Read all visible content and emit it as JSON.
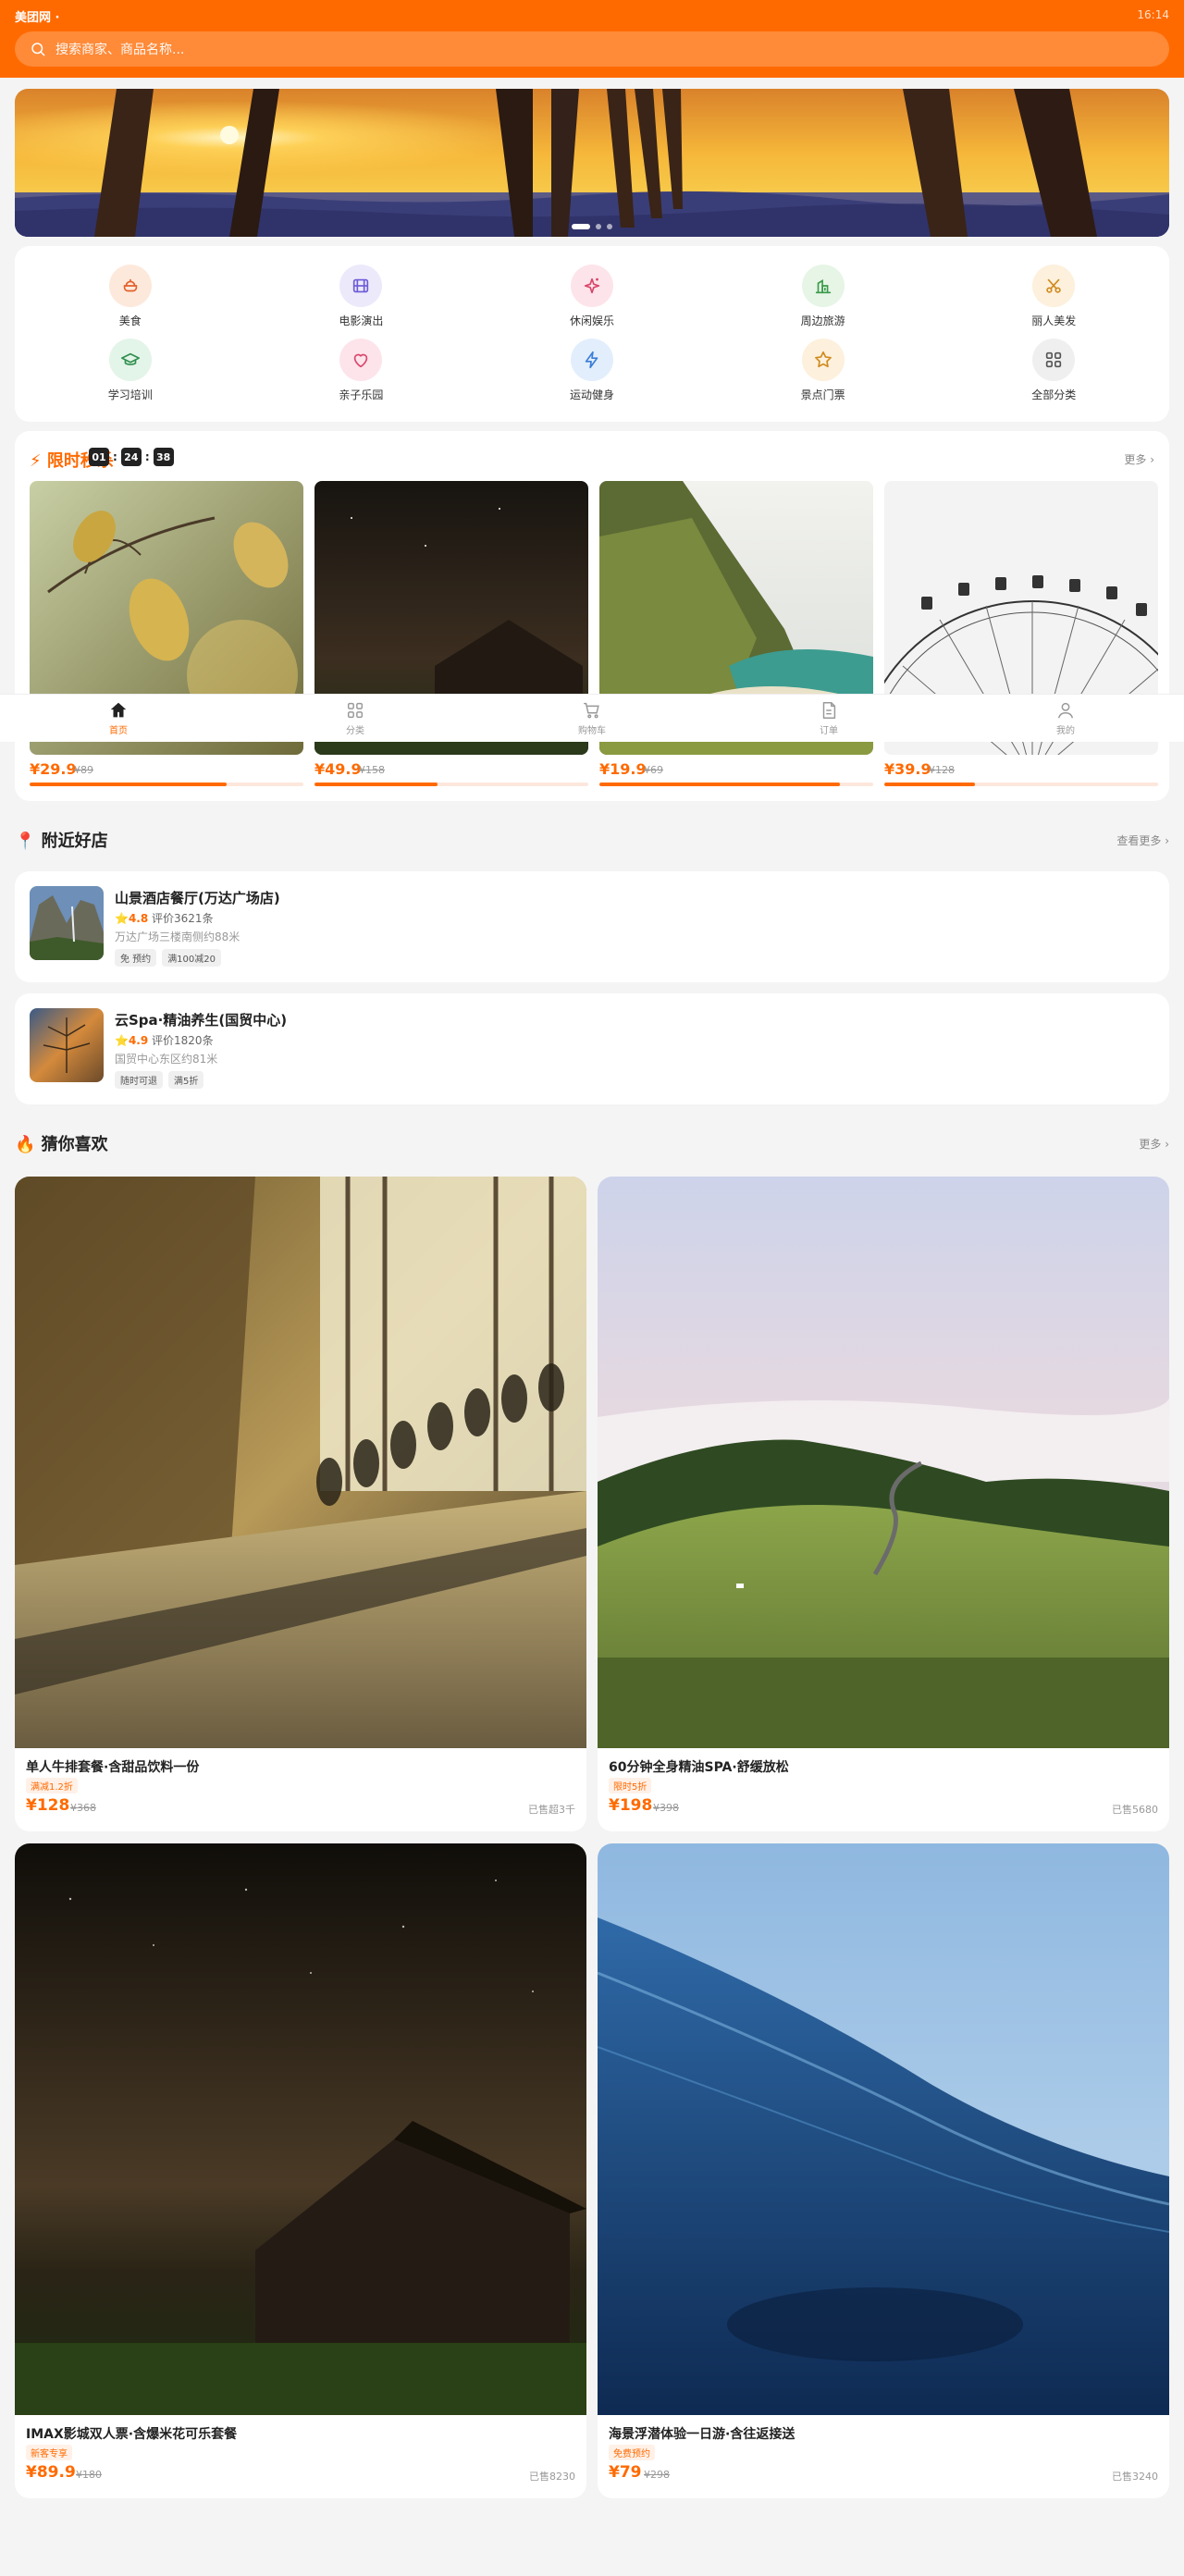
{
  "status": {
    "left": "美团网 ·",
    "time": "16:14"
  },
  "search": {
    "placeholder": "搜索商家、商品名称..."
  },
  "banner": {
    "slides": 3,
    "active": 0
  },
  "categories": [
    {
      "label": "美食",
      "icon": "food-icon",
      "bg": "#fde9dc",
      "color": "#e2602a"
    },
    {
      "label": "电影演出",
      "icon": "film-icon",
      "bg": "#ece9fb",
      "color": "#6b5bd6"
    },
    {
      "label": "休闲娱乐",
      "icon": "sparkle-icon",
      "bg": "#fde4ea",
      "color": "#d9456b"
    },
    {
      "label": "周边旅游",
      "icon": "city-icon",
      "bg": "#e6f5e6",
      "color": "#3a9a4a"
    },
    {
      "label": "丽人美发",
      "icon": "scissors-icon",
      "bg": "#fdf0dc",
      "color": "#d08a1e"
    },
    {
      "label": "学习培训",
      "icon": "graduation-icon",
      "bg": "#e3f4e8",
      "color": "#2f8f4e"
    },
    {
      "label": "亲子乐园",
      "icon": "heart-icon",
      "bg": "#fde4ea",
      "color": "#d9456b"
    },
    {
      "label": "运动健身",
      "icon": "bolt-icon",
      "bg": "#e2eefc",
      "color": "#3b7dd8"
    },
    {
      "label": "景点门票",
      "icon": "star-icon",
      "bg": "#fdf0dc",
      "color": "#d08a1e"
    },
    {
      "label": "全部分类",
      "icon": "grid-icon",
      "bg": "#efefef",
      "color": "#555"
    }
  ],
  "flash": {
    "title": "⚡ 限时秒杀",
    "timer": [
      "01",
      "24",
      "38"
    ],
    "more": "更多 ›",
    "items": [
      {
        "price": "¥29.9",
        "orig": "¥89",
        "progress": 0.72
      },
      {
        "price": "¥49.9",
        "orig": "¥158",
        "progress": 0.45
      },
      {
        "price": "¥19.9",
        "orig": "¥69",
        "progress": 0.88
      },
      {
        "price": "¥39.9",
        "orig": "¥128",
        "progress": 0.33
      }
    ]
  },
  "tabs": [
    {
      "label": "首页",
      "icon": "home-icon",
      "active": true
    },
    {
      "label": "分类",
      "icon": "grid-icon",
      "active": false
    },
    {
      "label": "购物车",
      "icon": "cart-icon",
      "active": false
    },
    {
      "label": "订单",
      "icon": "order-icon",
      "active": false
    },
    {
      "label": "我的",
      "icon": "user-icon",
      "active": false
    }
  ],
  "nearby": {
    "title": "📍 附近好店",
    "more": "查看更多 ›",
    "stores": [
      {
        "name": "山景酒店餐厅(万达广场店)",
        "rating": "⭐4.8",
        "reviews": "评价3621条",
        "address": "万达广场三楼南侧约88米",
        "tags": [
          "免 预约",
          "满100减20"
        ]
      },
      {
        "name": "云Spa·精油养生(国贸中心)",
        "rating": "⭐4.9",
        "reviews": "评价1820条",
        "address": "国贸中心东区约81米",
        "tags": [
          "随时可退",
          "满5折"
        ]
      }
    ]
  },
  "guess": {
    "title": "🔥 猜你喜欢",
    "more": "更多 ›",
    "products": [
      {
        "name": "单人牛排套餐·含甜品饮料一份",
        "tag": "满减1.2折",
        "price": "¥128",
        "orig": "¥368",
        "sold": "已售超3千"
      },
      {
        "name": "60分钟全身精油SPA·舒缓放松",
        "tag": "限时5折",
        "price": "¥198",
        "orig": "¥398",
        "sold": "已售5680"
      },
      {
        "name": "IMAX影城双人票·含爆米花可乐套餐",
        "tag": "新客专享",
        "price": "¥89.9",
        "orig": "¥180",
        "sold": "已售8230"
      },
      {
        "name": "海景浮潜体验一日游·含往返接送",
        "tag": "免费预约",
        "price": "¥79",
        "orig": "¥298",
        "sold": "已售3240"
      }
    ]
  },
  "colors": {
    "brand": "#ff6a00",
    "background": "#f4f4f4"
  }
}
